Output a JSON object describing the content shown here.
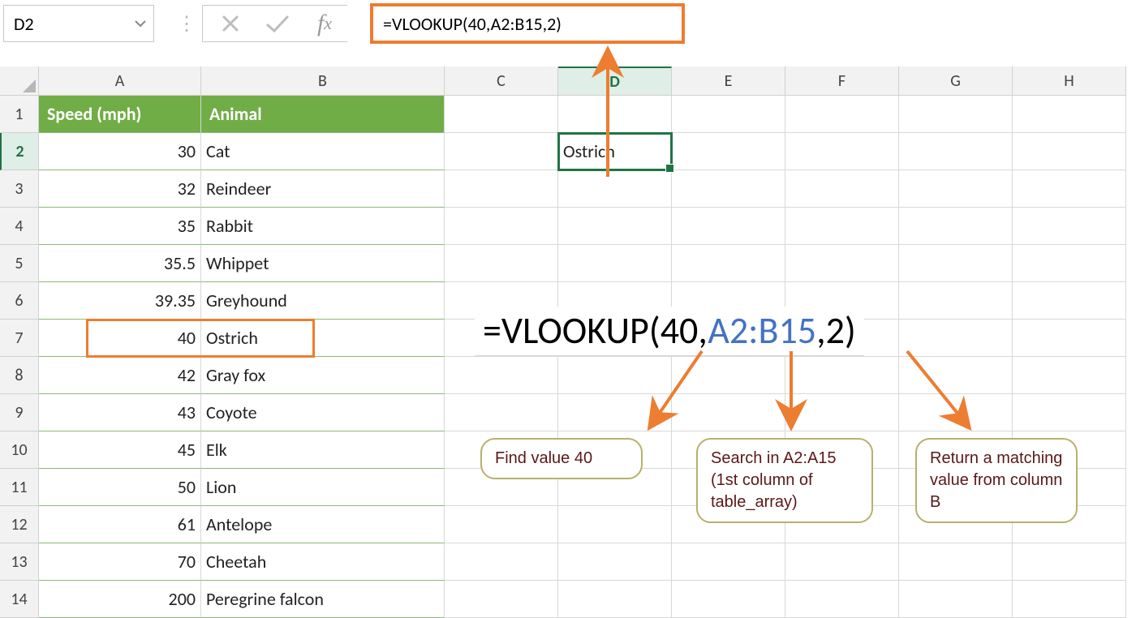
{
  "namebox": "D2",
  "formula": "=VLOOKUP(40,A2:B15,2)",
  "columns": [
    "A",
    "B",
    "C",
    "D",
    "E",
    "F",
    "G",
    "H"
  ],
  "rows": [
    "1",
    "2",
    "3",
    "4",
    "5",
    "6",
    "7",
    "8",
    "9",
    "10",
    "11",
    "12",
    "13",
    "14"
  ],
  "headers": {
    "a": "Speed (mph)",
    "b": "Animal"
  },
  "data": [
    {
      "speed": "30",
      "animal": "Cat"
    },
    {
      "speed": "32",
      "animal": "Reindeer"
    },
    {
      "speed": "35",
      "animal": "Rabbit"
    },
    {
      "speed": "35.5",
      "animal": "Whippet"
    },
    {
      "speed": "39.35",
      "animal": "Greyhound"
    },
    {
      "speed": "40",
      "animal": "Ostrich"
    },
    {
      "speed": "42",
      "animal": "Gray fox"
    },
    {
      "speed": "43",
      "animal": "Coyote"
    },
    {
      "speed": "45",
      "animal": "Elk"
    },
    {
      "speed": "50",
      "animal": "Lion"
    },
    {
      "speed": "61",
      "animal": "Antelope"
    },
    {
      "speed": "70",
      "animal": "Cheetah"
    },
    {
      "speed": "200",
      "animal": "Peregrine falcon"
    }
  ],
  "result_cell": "Ostrich",
  "bigformula": {
    "prefix": "=VLOOKUP(40,",
    "range": "A2:B15",
    "suffix": ",2)"
  },
  "callouts": {
    "c1": "Find value 40",
    "c2": "Search in A2:A15 (1st column of table_array)",
    "c3": "Return a matching value from column B"
  }
}
